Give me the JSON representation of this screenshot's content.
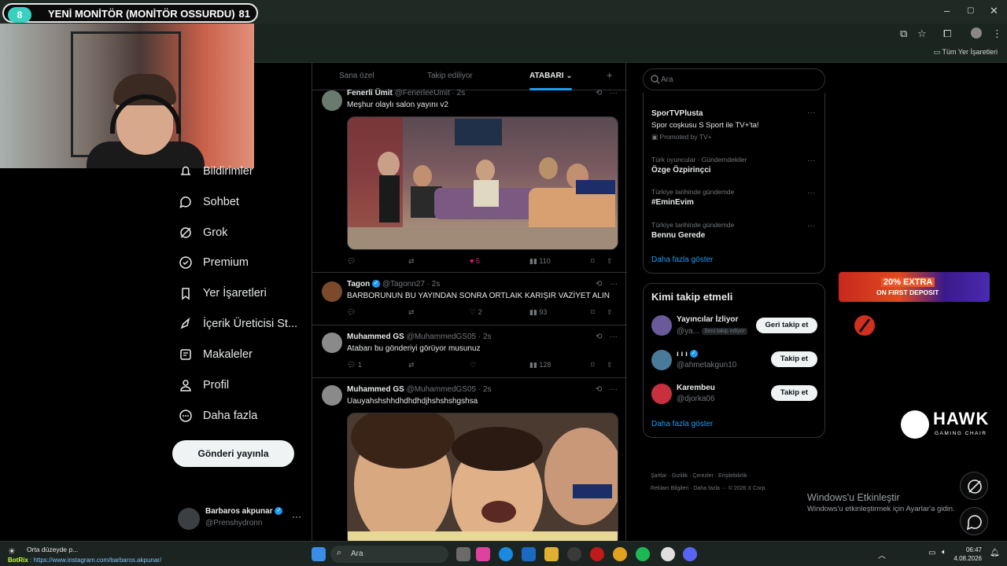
{
  "overlay": {
    "badge": "8",
    "title": "YENİ MONİTÖR (MONİTÖR OSSURDU)",
    "count": "81"
  },
  "browser": {
    "bookmarks_label": "Tüm Yer İşaretleri"
  },
  "nav": {
    "items": [
      {
        "label": "Bildirimler",
        "icon": "bell-icon"
      },
      {
        "label": "Sohbet",
        "icon": "chat-icon"
      },
      {
        "label": "Grok",
        "icon": "grok-icon"
      },
      {
        "label": "Premium",
        "icon": "premium-icon"
      },
      {
        "label": "Yer İşaretleri",
        "icon": "bookmark-icon"
      },
      {
        "label": "İçerik Üreticisi St...",
        "icon": "rocket-icon"
      },
      {
        "label": "Makaleler",
        "icon": "article-icon"
      },
      {
        "label": "Profil",
        "icon": "profile-icon"
      },
      {
        "label": "Daha fazla",
        "icon": "more-circle-icon"
      }
    ],
    "post_button": "Gönderi yayınla",
    "account": {
      "name": "Barbaros akpunar",
      "handle": "@Prenshydronn"
    }
  },
  "tabs": [
    "Sana özel",
    "Takip ediliyor",
    "ATABARI"
  ],
  "tweets": [
    {
      "name": "Fenerli Ümit",
      "handle": "@FenerleeUmit",
      "time": "· 2s",
      "text": "Meşhur olaylı salon yayını v2",
      "replies": "",
      "reposts": "",
      "likes": "5",
      "views": "110"
    },
    {
      "name": "Tagon",
      "handle": "@Tagonn27",
      "time": "· 2s",
      "text": "BARBORUNUN BU YAYINDAN SONRA ORTLAIK KARIŞIR VAZİYET ALIN",
      "replies": "",
      "reposts": "",
      "likes": "2",
      "views": "93"
    },
    {
      "name": "Muhammed GS",
      "handle": "@MuhammedGS05",
      "time": "· 2s",
      "text": "Atabarı bu gönderiyi görüyor musunuz",
      "replies": "1",
      "reposts": "",
      "likes": "",
      "views": "128"
    },
    {
      "name": "Muhammed GS",
      "handle": "@MuhammedGS05",
      "time": "· 2s",
      "text": "Uauyahshshhdhdhdhdjhshshshgshsa"
    }
  ],
  "search": {
    "placeholder": "Ara"
  },
  "trends": [
    {
      "name": "SporTVPlusta",
      "sub": "Spor coşkusu S Sport ile TV+'ta!",
      "promo": "Promoted by TV+"
    },
    {
      "category": "Türk oyuncular · Gündemdekiler",
      "name": "Özge Özpirinçci"
    },
    {
      "category": "Türkiye tarihinde gündemde",
      "name": "#EminEvim"
    },
    {
      "category": "Türkiye tarihinde gündemde",
      "name": "Bennu Gerede"
    }
  ],
  "show_more": "Daha fazla göster",
  "who_to_follow": {
    "title": "Kimi takip etmeli",
    "users": [
      {
        "name": "Yayıncılar İzliyor",
        "handle": "@ya...",
        "follows_you": "Seni takip ediyor",
        "button": "Geri takip et",
        "verified": false
      },
      {
        "name": "ı ı ı",
        "handle": "@ahmetakgun10",
        "button": "Takip et",
        "verified": true
      },
      {
        "name": "Karembeu",
        "handle": "@djorka06",
        "button": "Takip et",
        "verified": false
      }
    ],
    "show_more": "Daha fazla göster"
  },
  "footer": {
    "links": [
      "Şartlar",
      "Gizlilik",
      "Çerezler",
      "Erişilebilirlik",
      "Reklam Bilgileri",
      "Daha fazla ···",
      "© 2026 X Corp."
    ]
  },
  "ad": {
    "line1": "20% EXTRA",
    "line2": "ON FIRST DEPOSIT"
  },
  "hawk": {
    "brand": "HAWK",
    "sub": "GAMING CHAIR"
  },
  "windows": {
    "line1": "Windows'u Etkinleştir",
    "line2": "Windows'u etkinleştirmek için Ayarlar'a gidin."
  },
  "taskbar": {
    "search": "Ara",
    "weather": "Orta düzeyde p...",
    "bot_prefix": "BotRix",
    "bot_link": "https://www.instagram.com/barbaros.akpunar/",
    "time": "06:47",
    "date": "4.08.2026"
  }
}
